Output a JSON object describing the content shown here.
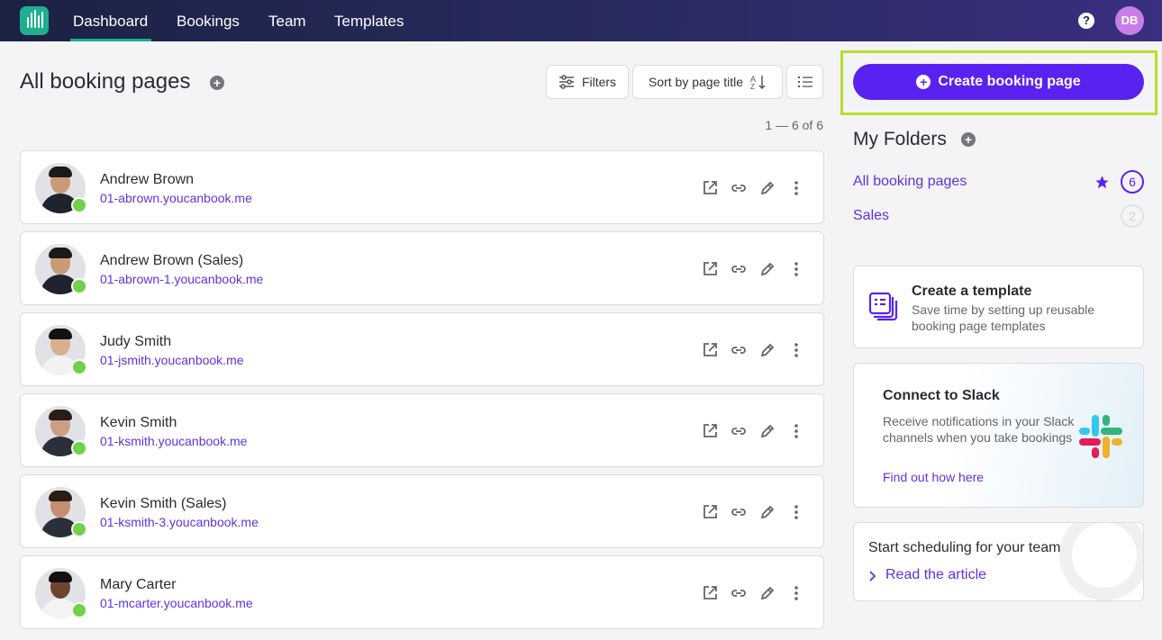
{
  "nav": {
    "items": [
      "Dashboard",
      "Bookings",
      "Team",
      "Templates"
    ],
    "active": "Dashboard",
    "user_initials": "DB",
    "help": "?"
  },
  "header": {
    "title": "All booking pages",
    "filters_label": "Filters",
    "sort_label": "Sort by page title",
    "count_text": "1 — 6 of 6"
  },
  "booking_pages": [
    {
      "name": "Andrew Brown",
      "url": "01-abrown.youcanbook.me"
    },
    {
      "name": "Andrew Brown (Sales)",
      "url": "01-abrown-1.youcanbook.me"
    },
    {
      "name": "Judy Smith",
      "url": "01-jsmith.youcanbook.me"
    },
    {
      "name": "Kevin Smith",
      "url": "01-ksmith.youcanbook.me"
    },
    {
      "name": "Kevin Smith (Sales)",
      "url": "01-ksmith-3.youcanbook.me"
    },
    {
      "name": "Mary Carter",
      "url": "01-mcarter.youcanbook.me"
    }
  ],
  "sidebar": {
    "create_button": "Create booking page",
    "folders_title": "My Folders",
    "folders": [
      {
        "label": "All booking pages",
        "count": "6"
      },
      {
        "label": "Sales",
        "count": "2"
      }
    ],
    "template_card": {
      "title": "Create a template",
      "desc": "Save time by setting up reusable booking page templates"
    },
    "slack_card": {
      "title": "Connect to Slack",
      "desc": "Receive notifications in your Slack channels when you take bookings",
      "link": "Find out how here"
    },
    "team_card": {
      "title": "Start scheduling for your team",
      "link": "Read the article"
    }
  },
  "colors": {
    "accent": "#5a22f0",
    "link": "#5b34e0",
    "online": "#6fd24a",
    "highlight": "#b4e02a",
    "nav_bg": "#1b2244"
  }
}
